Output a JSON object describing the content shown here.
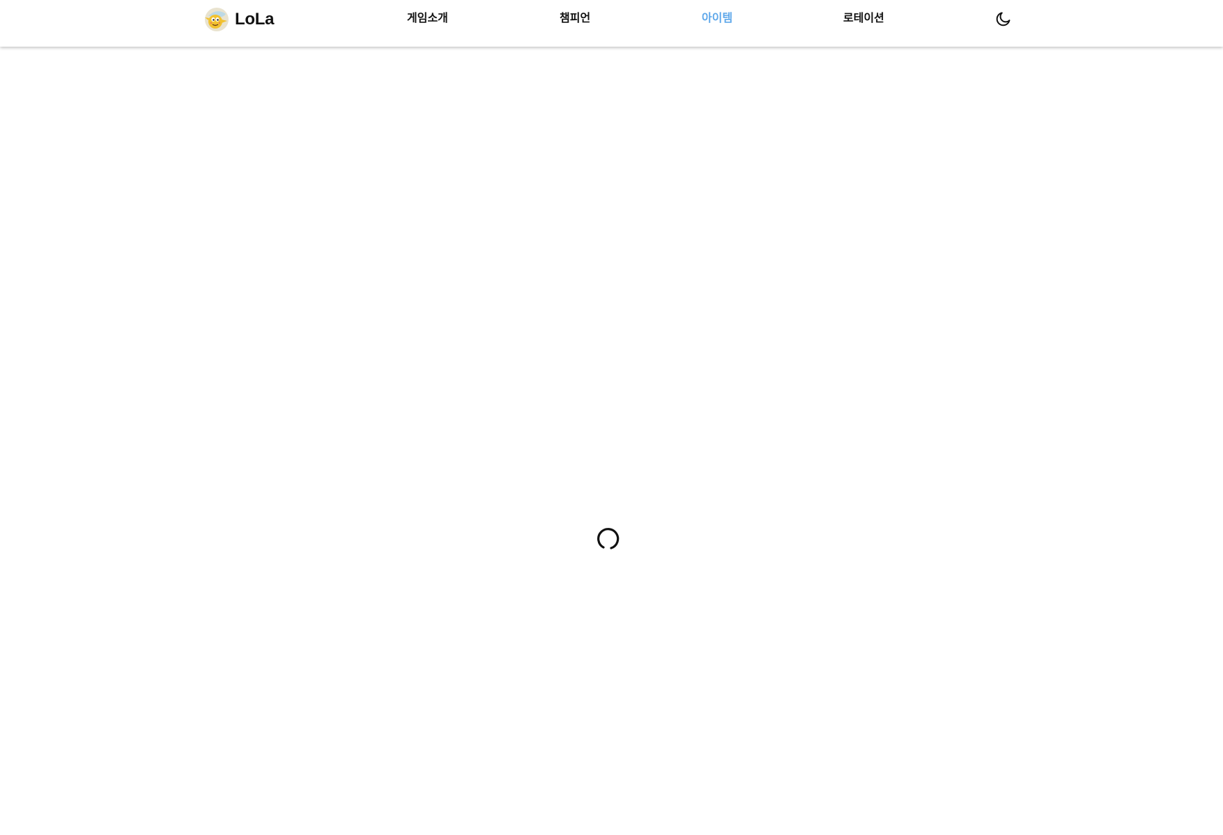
{
  "header": {
    "brand": "LoLa",
    "logo_icon": "lola-mascot-icon",
    "nav": [
      {
        "label": "게임소개",
        "active": false
      },
      {
        "label": "챔피언",
        "active": false
      },
      {
        "label": "아이템",
        "active": true
      },
      {
        "label": "로테이션",
        "active": false
      }
    ],
    "theme_toggle_icon": "moon-icon"
  },
  "main": {
    "loading_icon": "loading-spinner-icon"
  },
  "colors": {
    "active_nav": "#5fa8ea",
    "text": "#111111",
    "background": "#ffffff"
  }
}
